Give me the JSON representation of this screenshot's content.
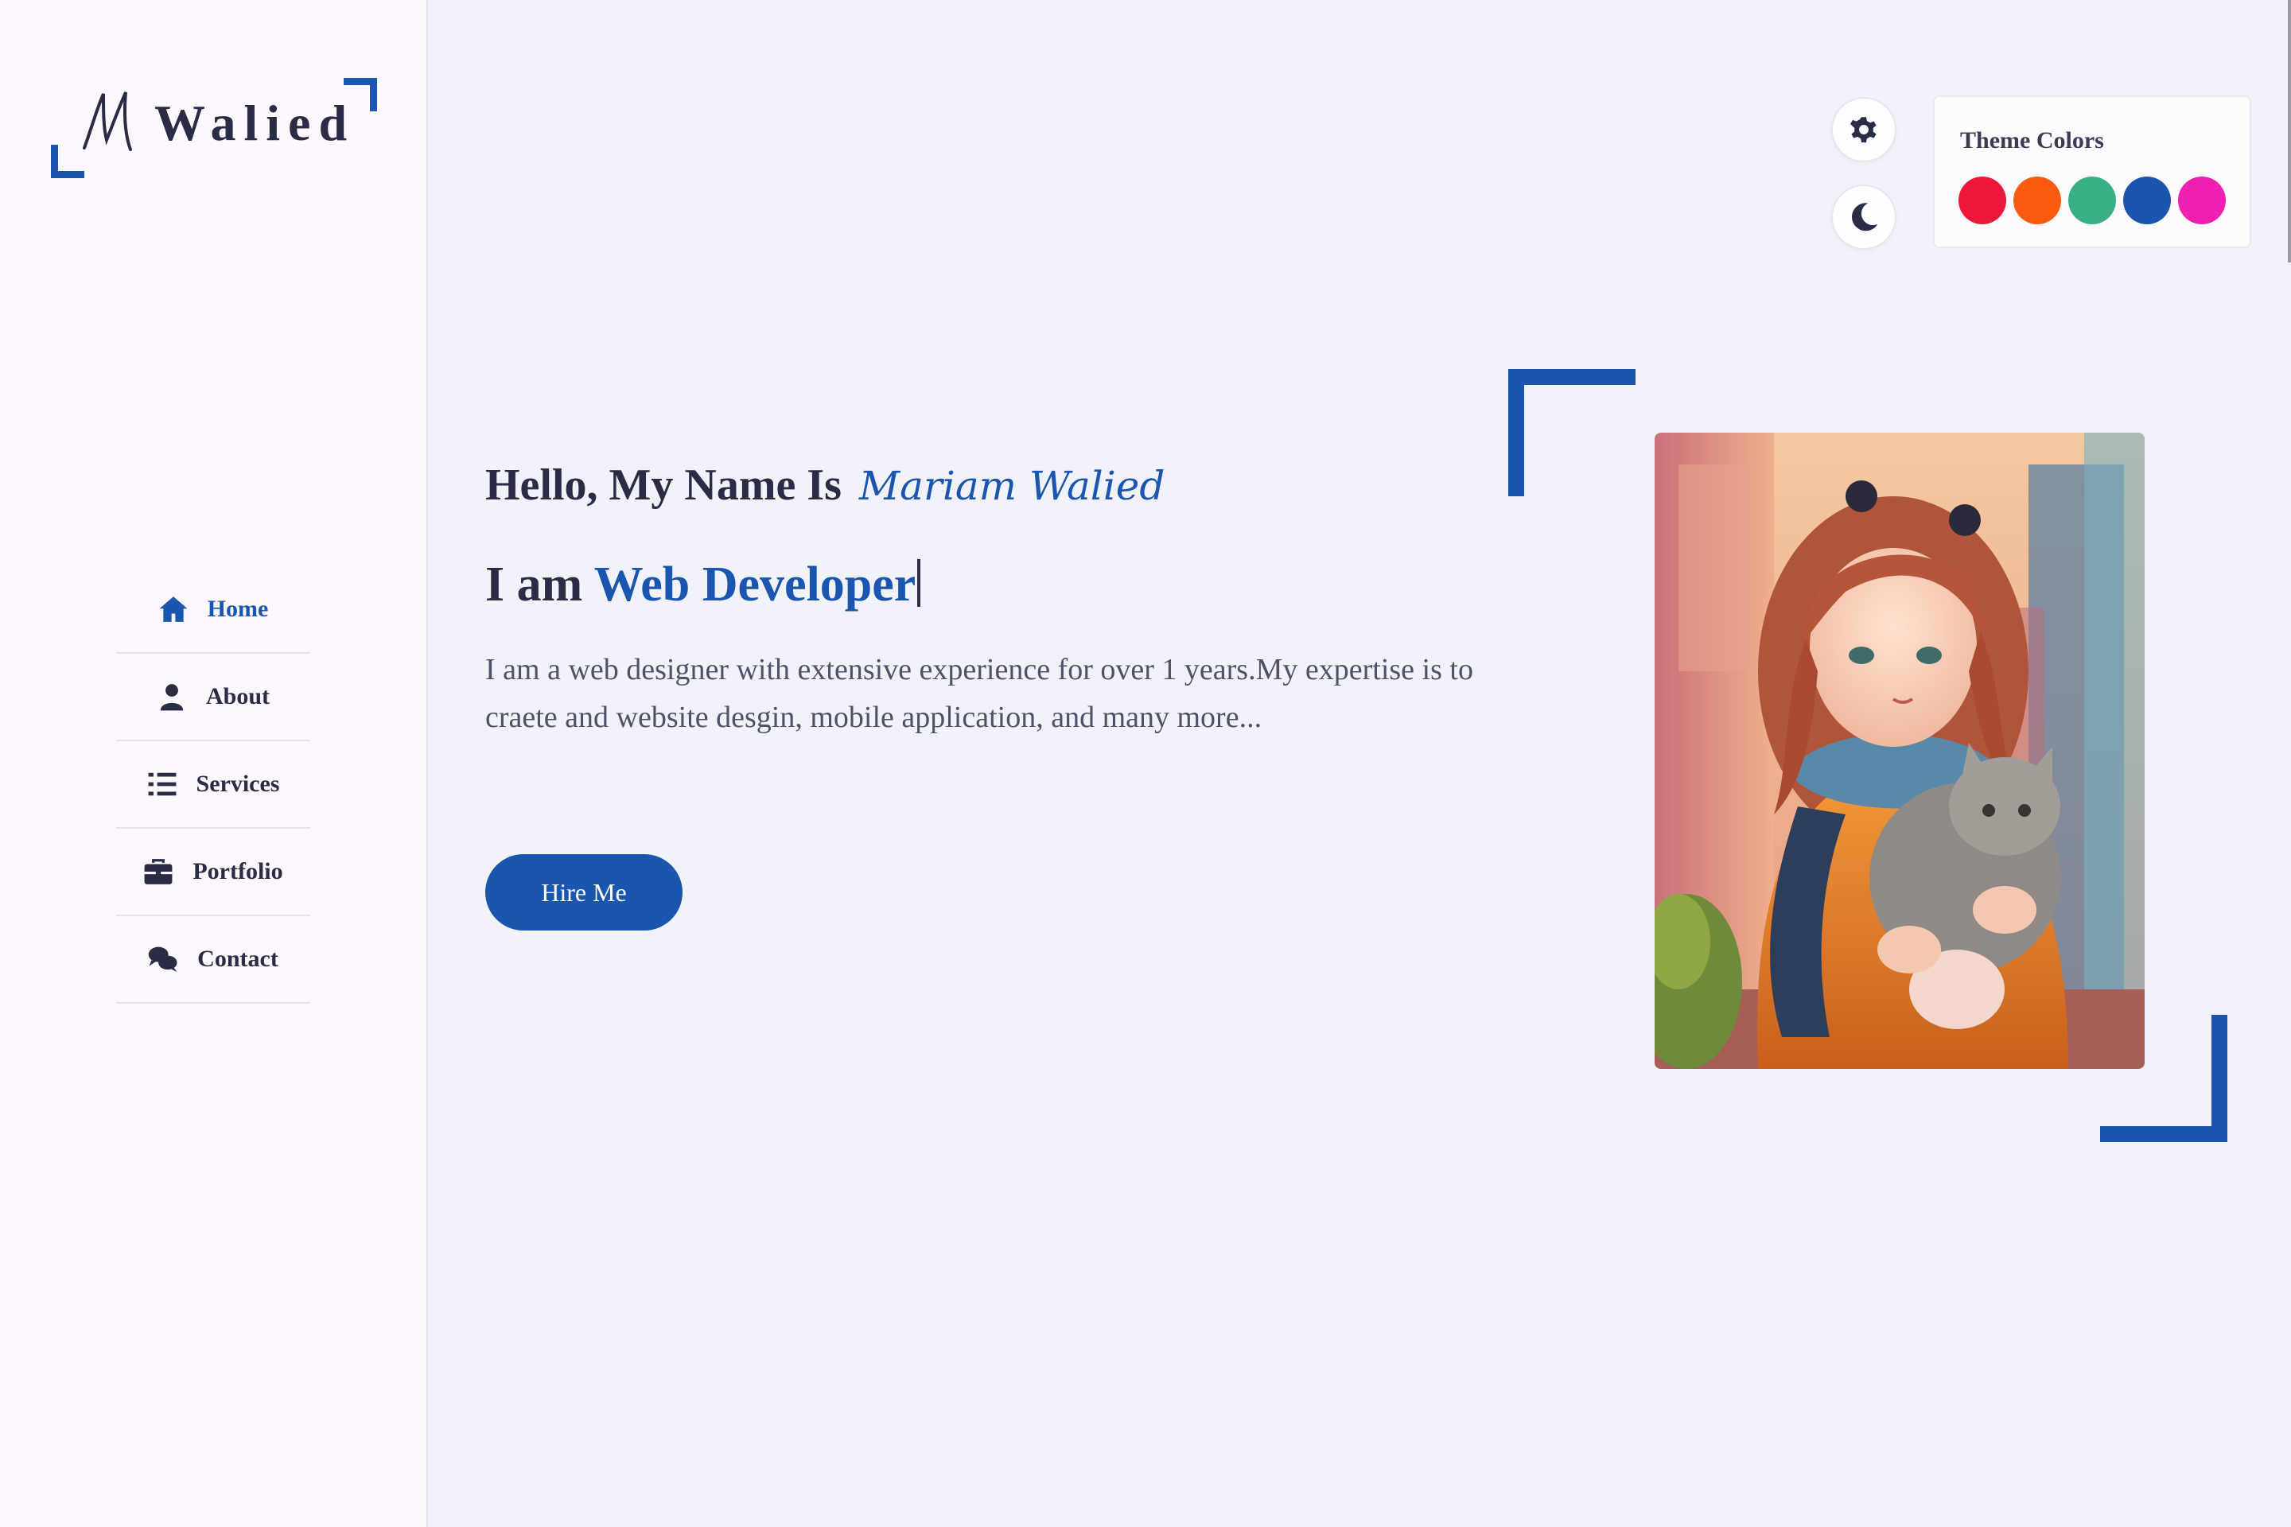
{
  "brand": {
    "name": "Walied",
    "mark": "M"
  },
  "nav": {
    "items": [
      {
        "label": "Home",
        "icon": "home-icon",
        "active": true
      },
      {
        "label": "About",
        "icon": "user-icon",
        "active": false
      },
      {
        "label": "Services",
        "icon": "list-icon",
        "active": false
      },
      {
        "label": "Portfolio",
        "icon": "briefcase-icon",
        "active": false
      },
      {
        "label": "Contact",
        "icon": "chat-icon",
        "active": false
      }
    ]
  },
  "toolbar": {
    "settings_icon": "gear-icon",
    "mode_icon": "moon-icon"
  },
  "theme": {
    "title": "Theme Colors",
    "colors": [
      "#ec1839",
      "#fa5b0f",
      "#37b182",
      "#1a55b0",
      "#f021b2"
    ]
  },
  "hero": {
    "greeting": "Hello, My Name Is",
    "name": "Mariam Walied",
    "role_prefix": "I am",
    "role": "Web Developer",
    "description": "I am a web designer with extensive experience for over 1 years.My expertise is to craete and website desgin, mobile application, and many more...",
    "cta": "Hire Me"
  },
  "colors": {
    "accent": "#1a55b0",
    "text": "#2a2b45",
    "background": "#f2f3fa"
  }
}
